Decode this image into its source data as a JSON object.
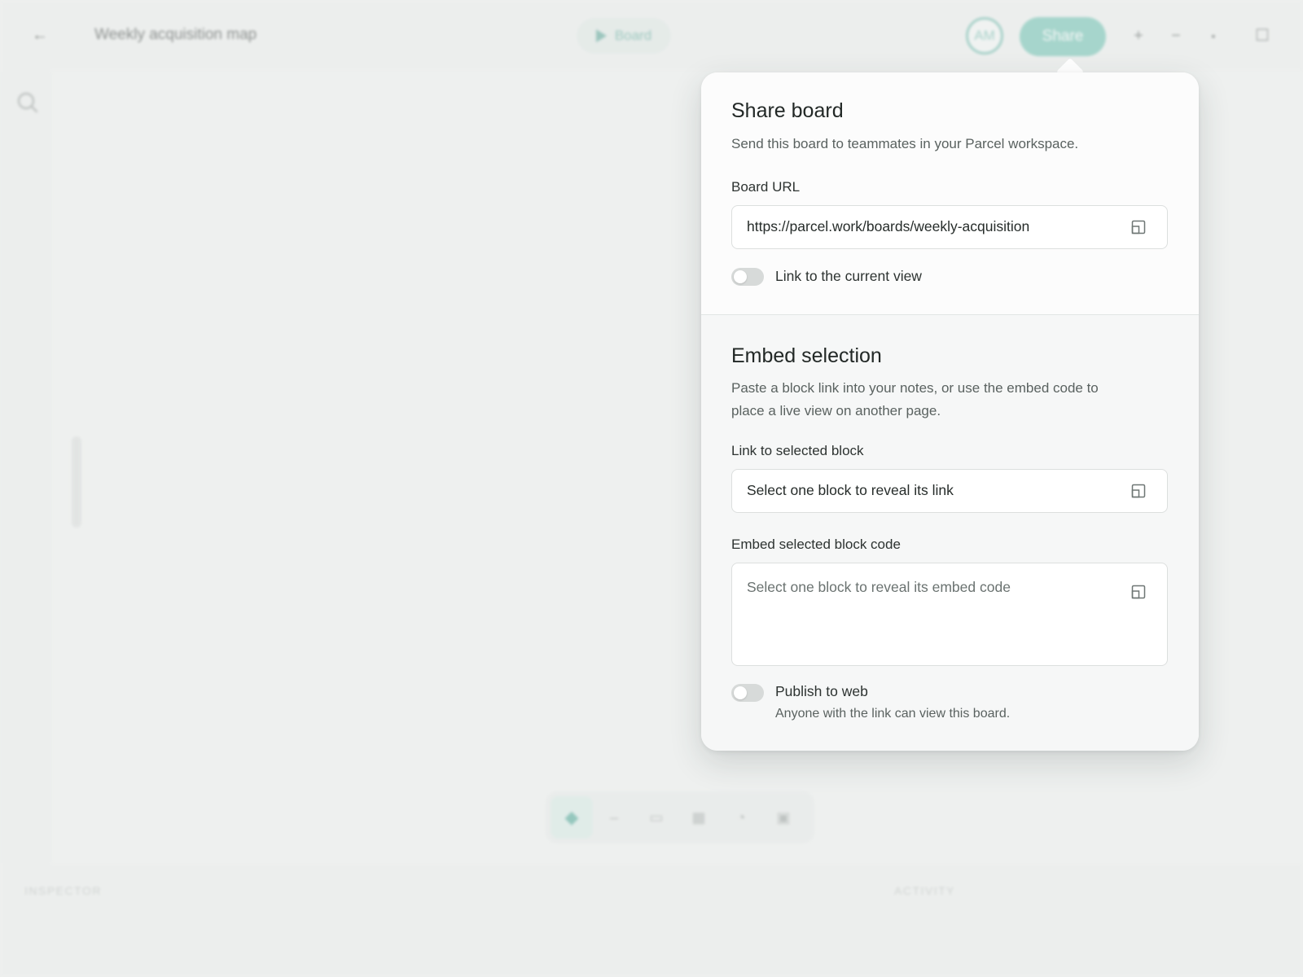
{
  "header": {
    "back_icon": "arrow-left-icon",
    "title": "Weekly acquisition map",
    "present_label": "Board",
    "avatar_initials": "AM",
    "share_label": "Share",
    "controls": [
      "+",
      "−",
      "▪",
      "☐"
    ]
  },
  "toolbar": {
    "tools": [
      "◆",
      "–",
      "▭",
      "▦",
      "◔",
      "▣"
    ]
  },
  "panels": {
    "inspector": "INSPECTOR",
    "activity": "ACTIVITY"
  },
  "share": {
    "title": "Share board",
    "description": "Send this board to teammates in your Parcel workspace.",
    "url_label": "Board URL",
    "url_value": "https://parcel.work/boards/weekly-acquisition",
    "current_view_label": "Link to the current view",
    "current_view_on": false
  },
  "embed": {
    "title": "Embed selection",
    "description_line1": "Paste a block link into your notes, or use the embed code to",
    "description_line2": "place a live view on another page.",
    "link_label": "Link to selected block",
    "link_placeholder": "Select one block to reveal its link",
    "code_label": "Embed selected block code",
    "code_placeholder": "Select one block to reveal its embed code",
    "publish_label": "Publish to web",
    "publish_hint": "Anyone with the link can view this board.",
    "publish_on": false
  },
  "colors": {
    "accent": "#6cc0b0",
    "accent_dark": "#4ea796"
  }
}
